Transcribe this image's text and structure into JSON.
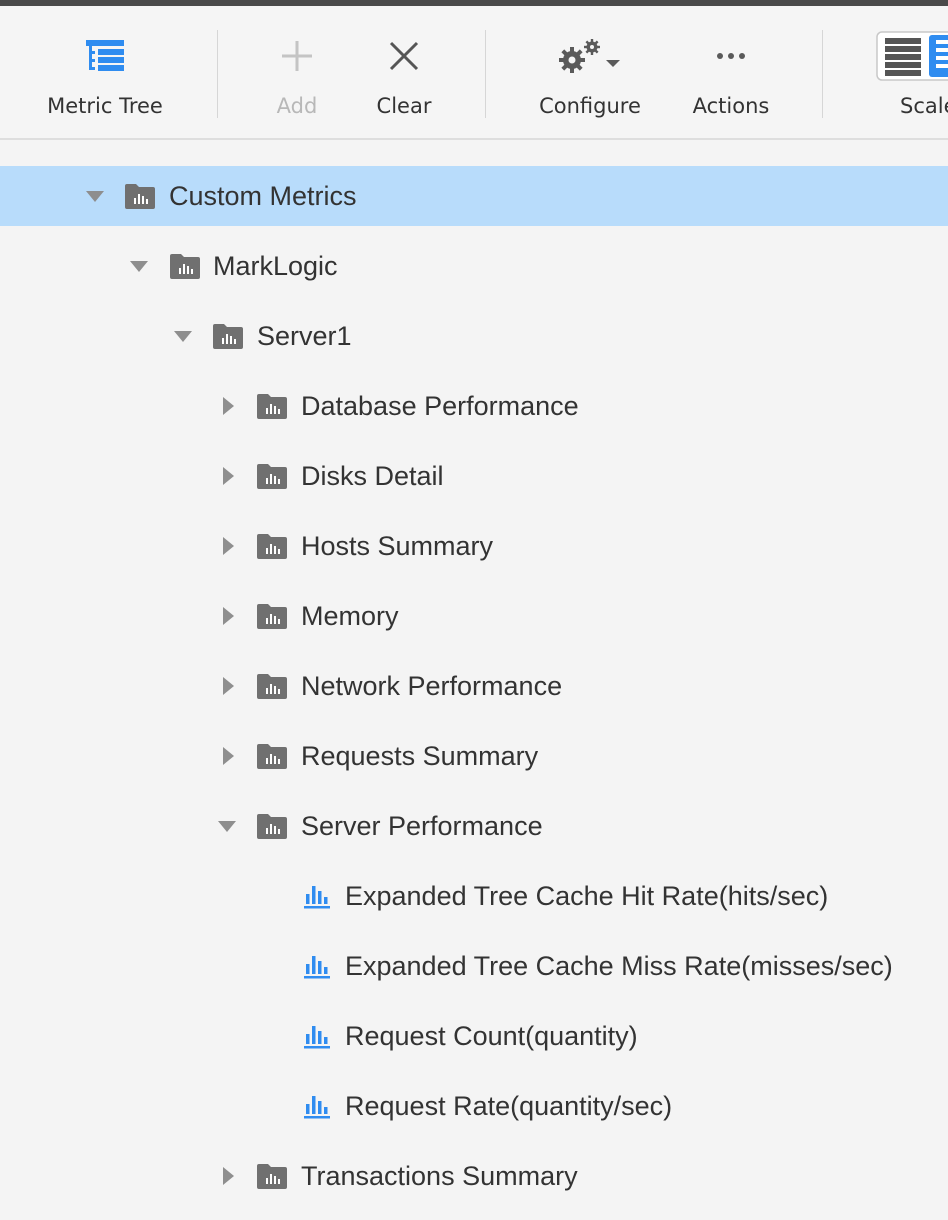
{
  "toolbar": {
    "metric_tree_label": "Metric Tree",
    "add_label": "Add",
    "clear_label": "Clear",
    "configure_label": "Configure",
    "actions_label": "Actions",
    "scale_label": "Scale",
    "actions_icon": "•••"
  },
  "colors": {
    "accent": "#2f8cf0",
    "selected_row": "#b8dcfb",
    "folder_icon": "#707070",
    "disabled_text": "#b8b8b8"
  },
  "tree": {
    "custom_metrics": "Custom Metrics",
    "marklogic": "MarkLogic",
    "server1": "Server1",
    "database_performance": "Database Performance",
    "disks_detail": "Disks Detail",
    "hosts_summary": "Hosts Summary",
    "memory": "Memory",
    "network_performance": "Network Performance",
    "requests_summary": "Requests Summary",
    "server_performance": "Server Performance",
    "metric_hit_rate": "Expanded Tree Cache Hit Rate(hits/sec)",
    "metric_miss_rate": "Expanded Tree Cache Miss Rate(misses/sec)",
    "metric_request_count": "Request Count(quantity)",
    "metric_request_rate": "Request Rate(quantity/sec)",
    "transactions_summary": "Transactions Summary"
  }
}
